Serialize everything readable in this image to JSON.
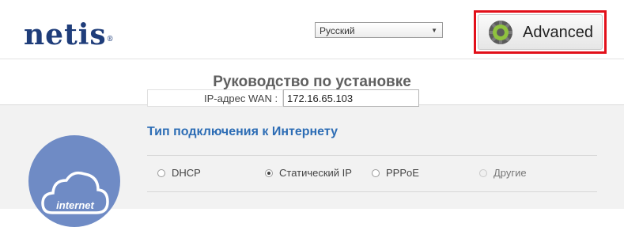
{
  "header": {
    "logo_text": "netis",
    "logo_mark": "®",
    "language": {
      "selected": "Русский"
    },
    "advanced_button": {
      "label": "Advanced",
      "icon": "gear-icon"
    },
    "highlight_color": "#e2101a"
  },
  "page": {
    "title": "Руководство по установке"
  },
  "connection": {
    "section_title": "Тип подключения к Интернету",
    "internet_icon_label": "internet",
    "options": [
      {
        "label": "DHCP",
        "selected": false,
        "disabled": false
      },
      {
        "label": "Статический IP",
        "selected": true,
        "disabled": false
      },
      {
        "label": "PPPoE",
        "selected": false,
        "disabled": false
      },
      {
        "label": "Другие",
        "selected": false,
        "disabled": true
      }
    ],
    "wan_ip": {
      "label": "IP-адрес WAN :",
      "value": "172.16.65.103"
    }
  },
  "colors": {
    "brand": "#1f3d7a",
    "accent": "#2d6db5",
    "icon_bg": "#6f8bc5"
  }
}
